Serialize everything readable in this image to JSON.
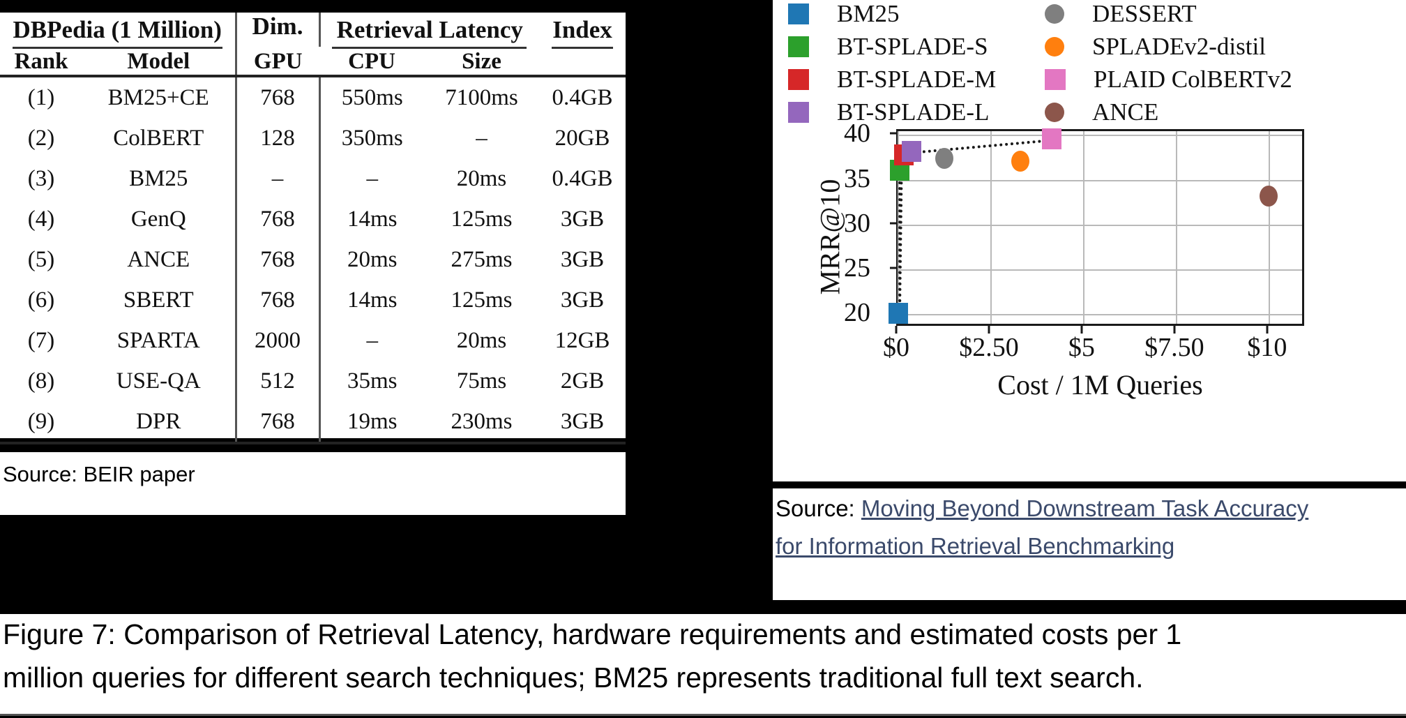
{
  "table": {
    "group_headers": [
      {
        "label": "DBPedia (1 Million)",
        "span": 2
      },
      {
        "label": "Retrieval Latency",
        "span": 2
      },
      {
        "label": "Index",
        "span": 1
      }
    ],
    "dim_header": "Dim.",
    "columns": [
      "Rank",
      "Model",
      "Dim.",
      "GPU",
      "CPU",
      "Size"
    ],
    "rows": [
      {
        "rank": "(1)",
        "model": "BM25+CE",
        "dim": "768",
        "gpu": "550ms",
        "cpu": "7100ms",
        "size": "0.4GB"
      },
      {
        "rank": "(2)",
        "model": "ColBERT",
        "dim": "128",
        "gpu": "350ms",
        "cpu": "–",
        "size": "20GB"
      },
      {
        "rank": "(3)",
        "model": "BM25",
        "dim": "–",
        "gpu": "–",
        "cpu": "20ms",
        "size": "0.4GB"
      },
      {
        "rank": "(4)",
        "model": "GenQ",
        "dim": "768",
        "gpu": "14ms",
        "cpu": "125ms",
        "size": "3GB"
      },
      {
        "rank": "(5)",
        "model": "ANCE",
        "dim": "768",
        "gpu": "20ms",
        "cpu": "275ms",
        "size": "3GB"
      },
      {
        "rank": "(6)",
        "model": "SBERT",
        "dim": "768",
        "gpu": "14ms",
        "cpu": "125ms",
        "size": "3GB"
      },
      {
        "rank": "(7)",
        "model": "SPARTA",
        "dim": "2000",
        "gpu": "–",
        "cpu": "20ms",
        "size": "12GB"
      },
      {
        "rank": "(8)",
        "model": "USE-QA",
        "dim": "512",
        "gpu": "35ms",
        "cpu": "75ms",
        "size": "2GB"
      },
      {
        "rank": "(9)",
        "model": "DPR",
        "dim": "768",
        "gpu": "19ms",
        "cpu": "230ms",
        "size": "3GB"
      }
    ]
  },
  "left_source": {
    "text": "Source: BEIR paper"
  },
  "right_source": {
    "prefix": "Source: ",
    "link_line1": "Moving Beyond Downstream Task Accuracy",
    "link_line2": "for Information Retrieval Benchmarking"
  },
  "caption": {
    "line1": "Figure 7: Comparison of Retrieval Latency, hardware requirements and estimated costs per 1",
    "line2": "million queries for different search techniques; BM25 represents traditional full text search."
  },
  "chart_data": {
    "type": "scatter",
    "title": "",
    "xlabel": "Cost / 1M Queries",
    "ylabel": "MRR@10",
    "xlim": [
      0,
      11
    ],
    "ylim": [
      18.5,
      40.5
    ],
    "xticks": [
      "$0",
      "$2.50",
      "$5",
      "$7.50",
      "$10"
    ],
    "xtick_values": [
      0,
      2.5,
      5,
      7.5,
      10
    ],
    "yticks": [
      "20",
      "25",
      "30",
      "35",
      "40"
    ],
    "ytick_values": [
      20,
      25,
      30,
      35,
      40
    ],
    "grid": true,
    "legend_position": "above-plot",
    "series": [
      {
        "name": "BM25",
        "marker": "square",
        "color": "#1f77b4",
        "x": 0.05,
        "y": 19.9
      },
      {
        "name": "BT-SPLADE-S",
        "marker": "square",
        "color": "#2ca02c",
        "x": 0.1,
        "y": 35.9
      },
      {
        "name": "BT-SPLADE-M",
        "marker": "square",
        "color": "#d62728",
        "x": 0.2,
        "y": 37.6
      },
      {
        "name": "BT-SPLADE-L",
        "marker": "square",
        "color": "#9467bd",
        "x": 0.42,
        "y": 38.0
      },
      {
        "name": "DESSERT",
        "marker": "circle",
        "color": "#7f7f7f",
        "x": 1.3,
        "y": 37.2
      },
      {
        "name": "SPLADEv2-distil",
        "marker": "circle",
        "color": "#ff7f0e",
        "x": 3.35,
        "y": 36.9
      },
      {
        "name": "PLAID ColBERTv2",
        "marker": "square",
        "color": "#e377c2",
        "x": 4.2,
        "y": 39.4
      },
      {
        "name": "ANCE",
        "marker": "circle",
        "color": "#8c564b",
        "x": 10.05,
        "y": 33.0
      }
    ],
    "pareto_path": [
      {
        "x": 0.05,
        "y": 19.9
      },
      {
        "x": 0.1,
        "y": 35.9
      },
      {
        "x": 0.2,
        "y": 37.6
      },
      {
        "x": 0.42,
        "y": 38.0
      },
      {
        "x": 4.2,
        "y": 39.4
      }
    ]
  }
}
